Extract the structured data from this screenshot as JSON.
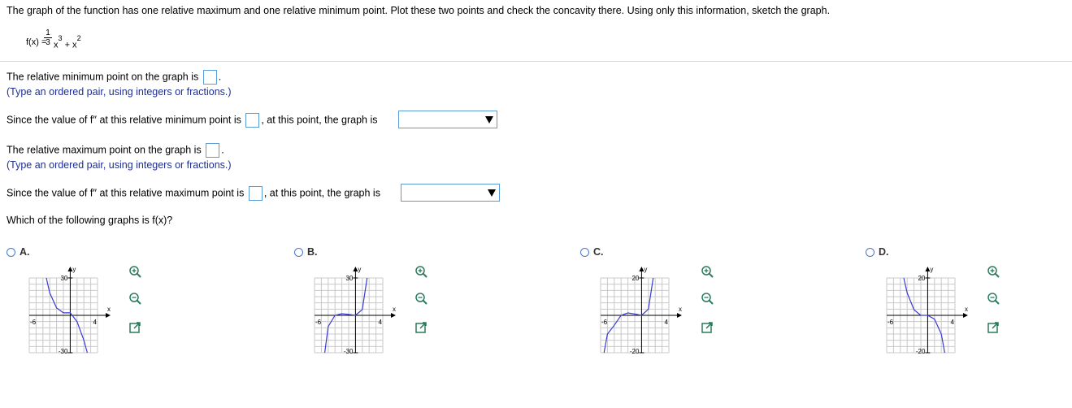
{
  "question": {
    "title": "The graph of the function has one relative maximum and one relative minimum point. Plot these two points and check the concavity there. Using only this information, sketch the graph.",
    "function": {
      "lhs": "f(x) =",
      "frac_num": "1",
      "frac_den": "3",
      "term1": "x",
      "term1_exp": "3",
      "plus": " + x",
      "term2_exp": "2"
    }
  },
  "parts": {
    "rel_min": {
      "label": "The relative minimum point on the graph is",
      "end": ".",
      "hint": "(Type an ordered pair, using integers or fractions.)"
    },
    "concavity_min": {
      "label": "Since the value of f′′ at this relative minimum point is",
      "middle": ", at this point, the graph is",
      "dropdown_value": ""
    },
    "rel_max": {
      "label": "The relative maximum point on the graph is",
      "end": ".",
      "hint": "(Type an ordered pair, using integers or fractions.)"
    },
    "concavity_max": {
      "label": "Since the value of f′′ at this relative maximum point is",
      "middle": ", at this point, the graph is",
      "dropdown_value": ""
    },
    "which_graph": "Which of the following graphs is f(x)?"
  },
  "options": [
    {
      "label": "A.",
      "y_top": "30",
      "y_bottom": "-30",
      "x_left": "-6",
      "x_right": "4",
      "x_axis": "x",
      "y_axis": "y"
    },
    {
      "label": "B.",
      "y_top": "30",
      "y_bottom": "-30",
      "x_left": "-6",
      "x_right": "4",
      "x_axis": "x",
      "y_axis": "y"
    },
    {
      "label": "C.",
      "y_top": "20",
      "y_bottom": "-20",
      "x_left": "-6",
      "x_right": "4",
      "x_axis": "x",
      "y_axis": "y"
    },
    {
      "label": "D.",
      "y_top": "20",
      "y_bottom": "-20",
      "x_left": "-6",
      "x_right": "4",
      "x_axis": "x",
      "y_axis": "y"
    }
  ],
  "chart_data": [
    {
      "type": "line",
      "label": "A",
      "xlim": [
        -6,
        4
      ],
      "ylim": [
        -30,
        30
      ],
      "grid": true,
      "series": [
        {
          "x": [
            -3.5,
            -3,
            -2,
            -1,
            0,
            1,
            2,
            2.5
          ],
          "y": [
            30,
            18,
            6,
            2,
            2,
            -5,
            -20,
            -30
          ]
        }
      ]
    },
    {
      "type": "line",
      "label": "B",
      "xlim": [
        -6,
        4
      ],
      "ylim": [
        -30,
        30
      ],
      "grid": true,
      "series": [
        {
          "x": [
            -4.5,
            -4,
            -3,
            -2,
            -1,
            0,
            1,
            1.7
          ],
          "y": [
            -30,
            -9,
            0,
            1.3,
            0.7,
            0,
            4.7,
            30
          ]
        }
      ]
    },
    {
      "type": "line",
      "label": "C",
      "xlim": [
        -6,
        4
      ],
      "ylim": [
        -20,
        20
      ],
      "grid": true,
      "series": [
        {
          "x": [
            -5.5,
            -5,
            -4,
            -3,
            -2,
            -1,
            0,
            1,
            1.7
          ],
          "y": [
            -20,
            -10,
            -5.3,
            0,
            1.3,
            0.7,
            0,
            3.3,
            20
          ]
        }
      ]
    },
    {
      "type": "line",
      "label": "D",
      "xlim": [
        -6,
        4
      ],
      "ylim": [
        -20,
        20
      ],
      "grid": true,
      "series": [
        {
          "x": [
            -3.5,
            -3,
            -2,
            -1,
            0,
            1,
            2,
            2.5
          ],
          "y": [
            20,
            12,
            3,
            0,
            0,
            -2,
            -10,
            -20
          ]
        }
      ]
    }
  ],
  "colors": {
    "curve": "#3b3bd6",
    "axis": "#000000",
    "grid": "#c8c8c8",
    "input_border": "#5b9bd5",
    "hint": "#1f2f8f"
  },
  "icons": [
    "zoom-in-icon",
    "zoom-out-icon",
    "open-external-icon"
  ]
}
